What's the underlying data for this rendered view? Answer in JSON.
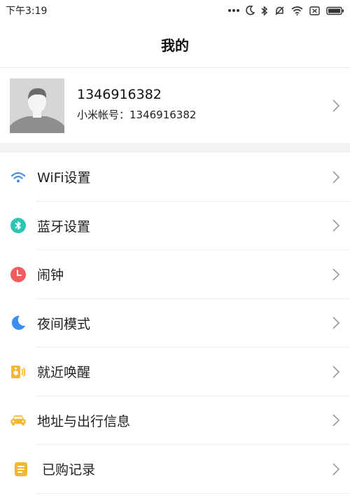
{
  "status_bar": {
    "time": "下午3:19",
    "icons": [
      "more-dots-icon",
      "moon-icon",
      "bluetooth-icon",
      "notifications-muted-icon",
      "wifi-icon",
      "sim-disabled-icon",
      "battery-icon"
    ]
  },
  "header": {
    "title": "我的"
  },
  "profile": {
    "name": "1346916382",
    "account_line": "小米帐号：1346916382",
    "avatar": "default-avatar-silhouette"
  },
  "menu": [
    {
      "label": "WiFi设置",
      "icon": "wifi-icon",
      "color": "#4a90e2"
    },
    {
      "label": "蓝牙设置",
      "icon": "bluetooth-icon",
      "color": "#2bc5b4"
    },
    {
      "label": "闹钟",
      "icon": "alarm-clock-icon",
      "color": "#f25c5c"
    },
    {
      "label": "夜间模式",
      "icon": "moon-icon",
      "color": "#3b8ff0"
    },
    {
      "label": "就近唤醒",
      "icon": "speaker-wake-icon",
      "color": "#f5b731"
    },
    {
      "label": "地址与出行信息",
      "icon": "car-icon",
      "color": "#f5b731"
    },
    {
      "label": "已购记录",
      "icon": "receipt-icon",
      "color": "#f5b731"
    }
  ],
  "colors": {
    "divider": "#ededed",
    "band": "#f2f2f2",
    "chevron": "#9a9a9a"
  }
}
